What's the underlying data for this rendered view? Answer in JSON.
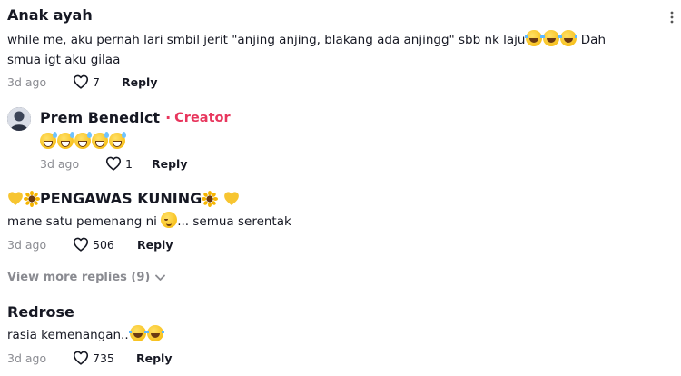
{
  "comments": [
    {
      "username": "Anak ayah",
      "text": "while me, aku pernah lari smbil jerit \"anjing anjing, blakang ada anjingg\" sbb nk laju",
      "text_tail": " Dah",
      "text_line2": "smua igt aku gilaa",
      "time": "3d ago",
      "likes": "7",
      "reply_label": "Reply"
    },
    {
      "username": "Prem Benedict",
      "badge": "Creator",
      "time": "3d ago",
      "likes": "1",
      "reply_label": "Reply"
    },
    {
      "username": "PENGAWAS KUNING",
      "text": "mane satu pemenang ni ",
      "text_tail": "... semua serentak",
      "time": "3d ago",
      "likes": "506",
      "reply_label": "Reply"
    },
    {
      "username": "Redrose",
      "text": "rasia kemenangan..",
      "time": "3d ago",
      "likes": "735",
      "reply_label": "Reply"
    }
  ],
  "view_more": "View more replies (9)",
  "icons": {
    "more": "more-icon",
    "heart": "heart-outline-icon",
    "chevron": "chevron-down-icon"
  },
  "colors": {
    "creator": "#e8365d",
    "meta": "#8a8b91",
    "text": "#161823"
  }
}
